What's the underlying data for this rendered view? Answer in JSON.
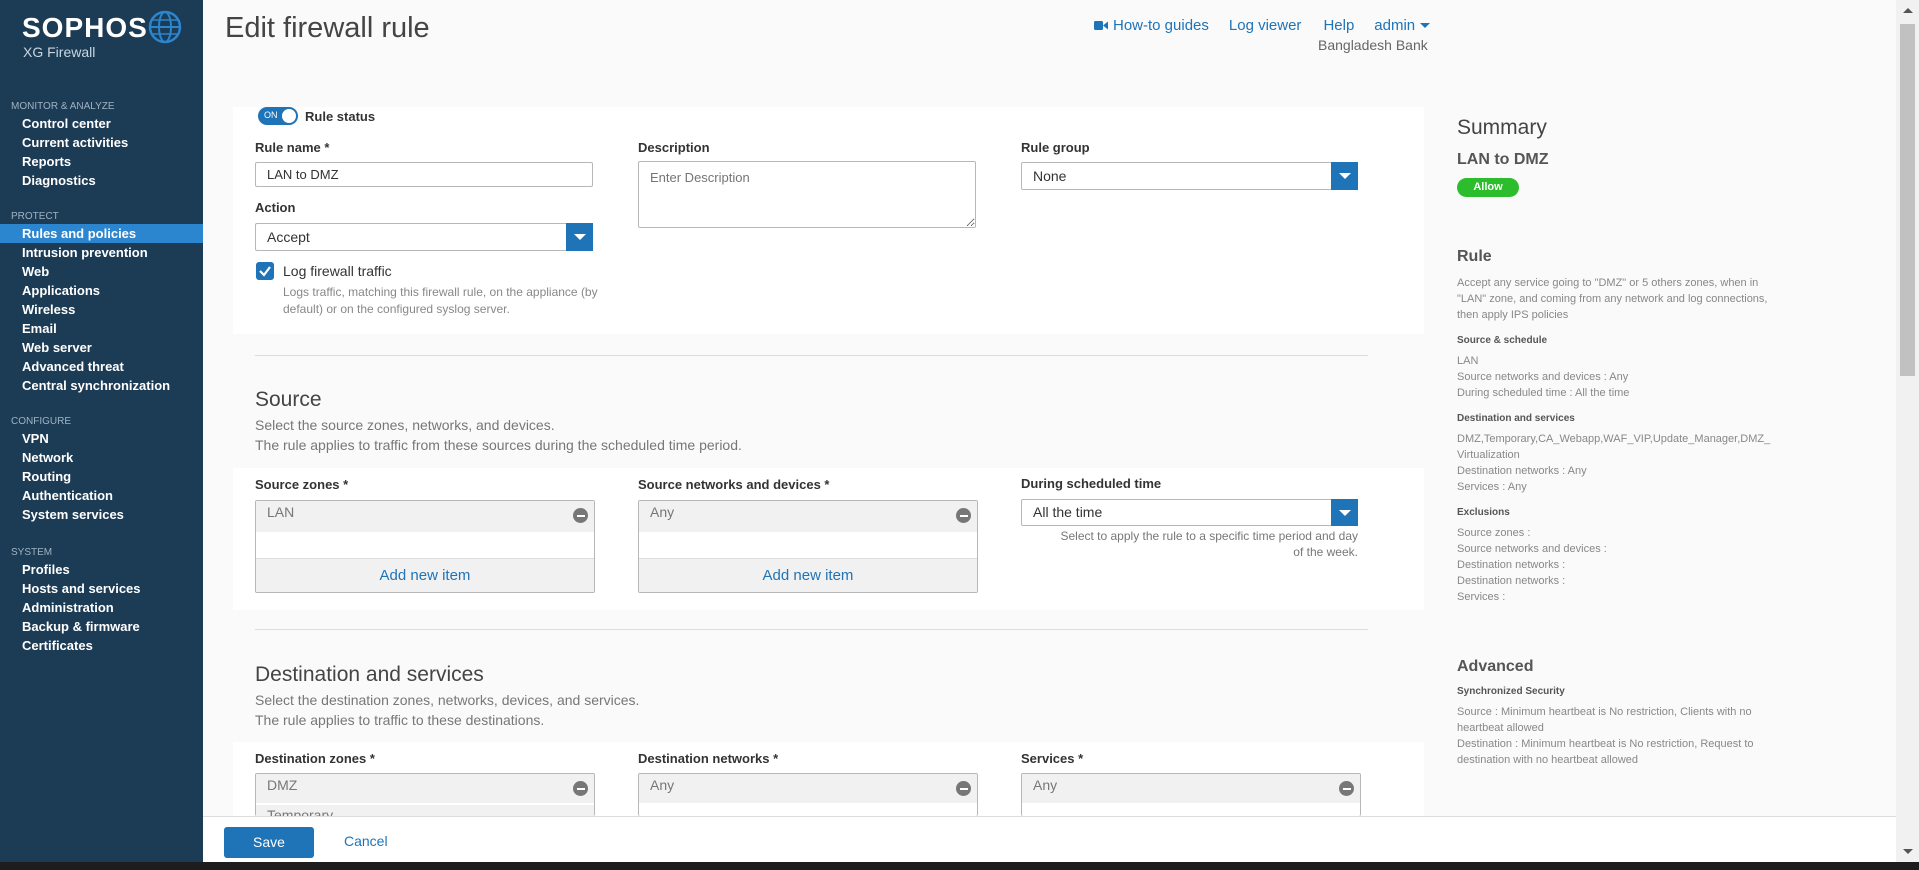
{
  "brand": {
    "name": "SOPHOS",
    "product": "XG Firewall"
  },
  "sidebar": {
    "sections": [
      {
        "title": "MONITOR & ANALYZE",
        "items": [
          "Control center",
          "Current activities",
          "Reports",
          "Diagnostics"
        ]
      },
      {
        "title": "PROTECT",
        "items": [
          "Rules and policies",
          "Intrusion prevention",
          "Web",
          "Applications",
          "Wireless",
          "Email",
          "Web server",
          "Advanced threat",
          "Central synchronization"
        ]
      },
      {
        "title": "CONFIGURE",
        "items": [
          "VPN",
          "Network",
          "Routing",
          "Authentication",
          "System services"
        ]
      },
      {
        "title": "SYSTEM",
        "items": [
          "Profiles",
          "Hosts and services",
          "Administration",
          "Backup & firmware",
          "Certificates"
        ]
      }
    ],
    "active_item": "Rules and policies"
  },
  "header": {
    "title": "Edit firewall rule",
    "links": {
      "howto": "How-to guides",
      "logviewer": "Log viewer",
      "help": "Help",
      "admin": "admin"
    },
    "org": "Bangladesh Bank"
  },
  "form": {
    "rule_status_toggle": "ON",
    "rule_status_label": "Rule status",
    "rule_name_label": "Rule name *",
    "rule_name_value": "LAN to DMZ",
    "description_label": "Description",
    "description_placeholder": "Enter Description",
    "rule_group_label": "Rule group",
    "rule_group_value": "None",
    "action_label": "Action",
    "action_value": "Accept",
    "log_label": "Log firewall traffic",
    "log_checked": true,
    "log_help": "Logs traffic, matching this firewall rule, on the appliance (by default) or on the configured syslog server."
  },
  "source": {
    "title": "Source",
    "desc1": "Select the source zones, networks, and devices.",
    "desc2": "The rule applies to traffic from these sources during the scheduled time period.",
    "zones_label": "Source zones *",
    "zones_value": "LAN",
    "networks_label": "Source networks and devices *",
    "networks_value": "Any",
    "add_new": "Add new item",
    "schedule_label": "During scheduled time",
    "schedule_value": "All the time",
    "schedule_help": "Select to apply the rule to a specific time period and day of the week."
  },
  "destination": {
    "title": "Destination and services",
    "desc1": "Select the destination zones, networks, devices, and services.",
    "desc2": "The rule applies to traffic to these destinations.",
    "zones_label": "Destination zones *",
    "zones_value": "DMZ",
    "zones_value2": "Temporary",
    "networks_label": "Destination networks *",
    "networks_value": "Any",
    "services_label": "Services *",
    "services_value": "Any"
  },
  "summary": {
    "title": "Summary",
    "rule_name": "LAN to DMZ",
    "badge": "Allow",
    "rule_heading": "Rule",
    "rule_text": "Accept any service going to \"DMZ\" or 5 others zones, when in \"LAN\" zone, and coming from any network and log connections, then apply IPS policies",
    "src_heading": "Source & schedule",
    "src_lines": [
      "LAN",
      "Source networks and devices : Any",
      "During scheduled time : All the time"
    ],
    "dst_heading": "Destination and services",
    "dst_lines": [
      "DMZ,Temporary,CA_Webapp,WAF_VIP,Update_Manager,DMZ_ Virtualization",
      "Destination networks : Any",
      "Services : Any"
    ],
    "excl_heading": "Exclusions",
    "excl_lines": [
      "Source zones :",
      "Source networks and devices :",
      "Destination networks :",
      "Destination networks :",
      "Services :"
    ],
    "adv_heading": "Advanced",
    "sync_heading": "Synchronized Security",
    "sync_lines": [
      "Source : Minimum heartbeat is No restriction, Clients with no heartbeat allowed",
      "Destination : Minimum heartbeat is No restriction, Request to destination with no heartbeat allowed"
    ]
  },
  "footer": {
    "save": "Save",
    "cancel": "Cancel"
  },
  "colors": {
    "sidebar": "#1c3b55",
    "accent": "#1f73b7",
    "active": "#2b85cf",
    "allow_badge": "#2bbd2b"
  }
}
